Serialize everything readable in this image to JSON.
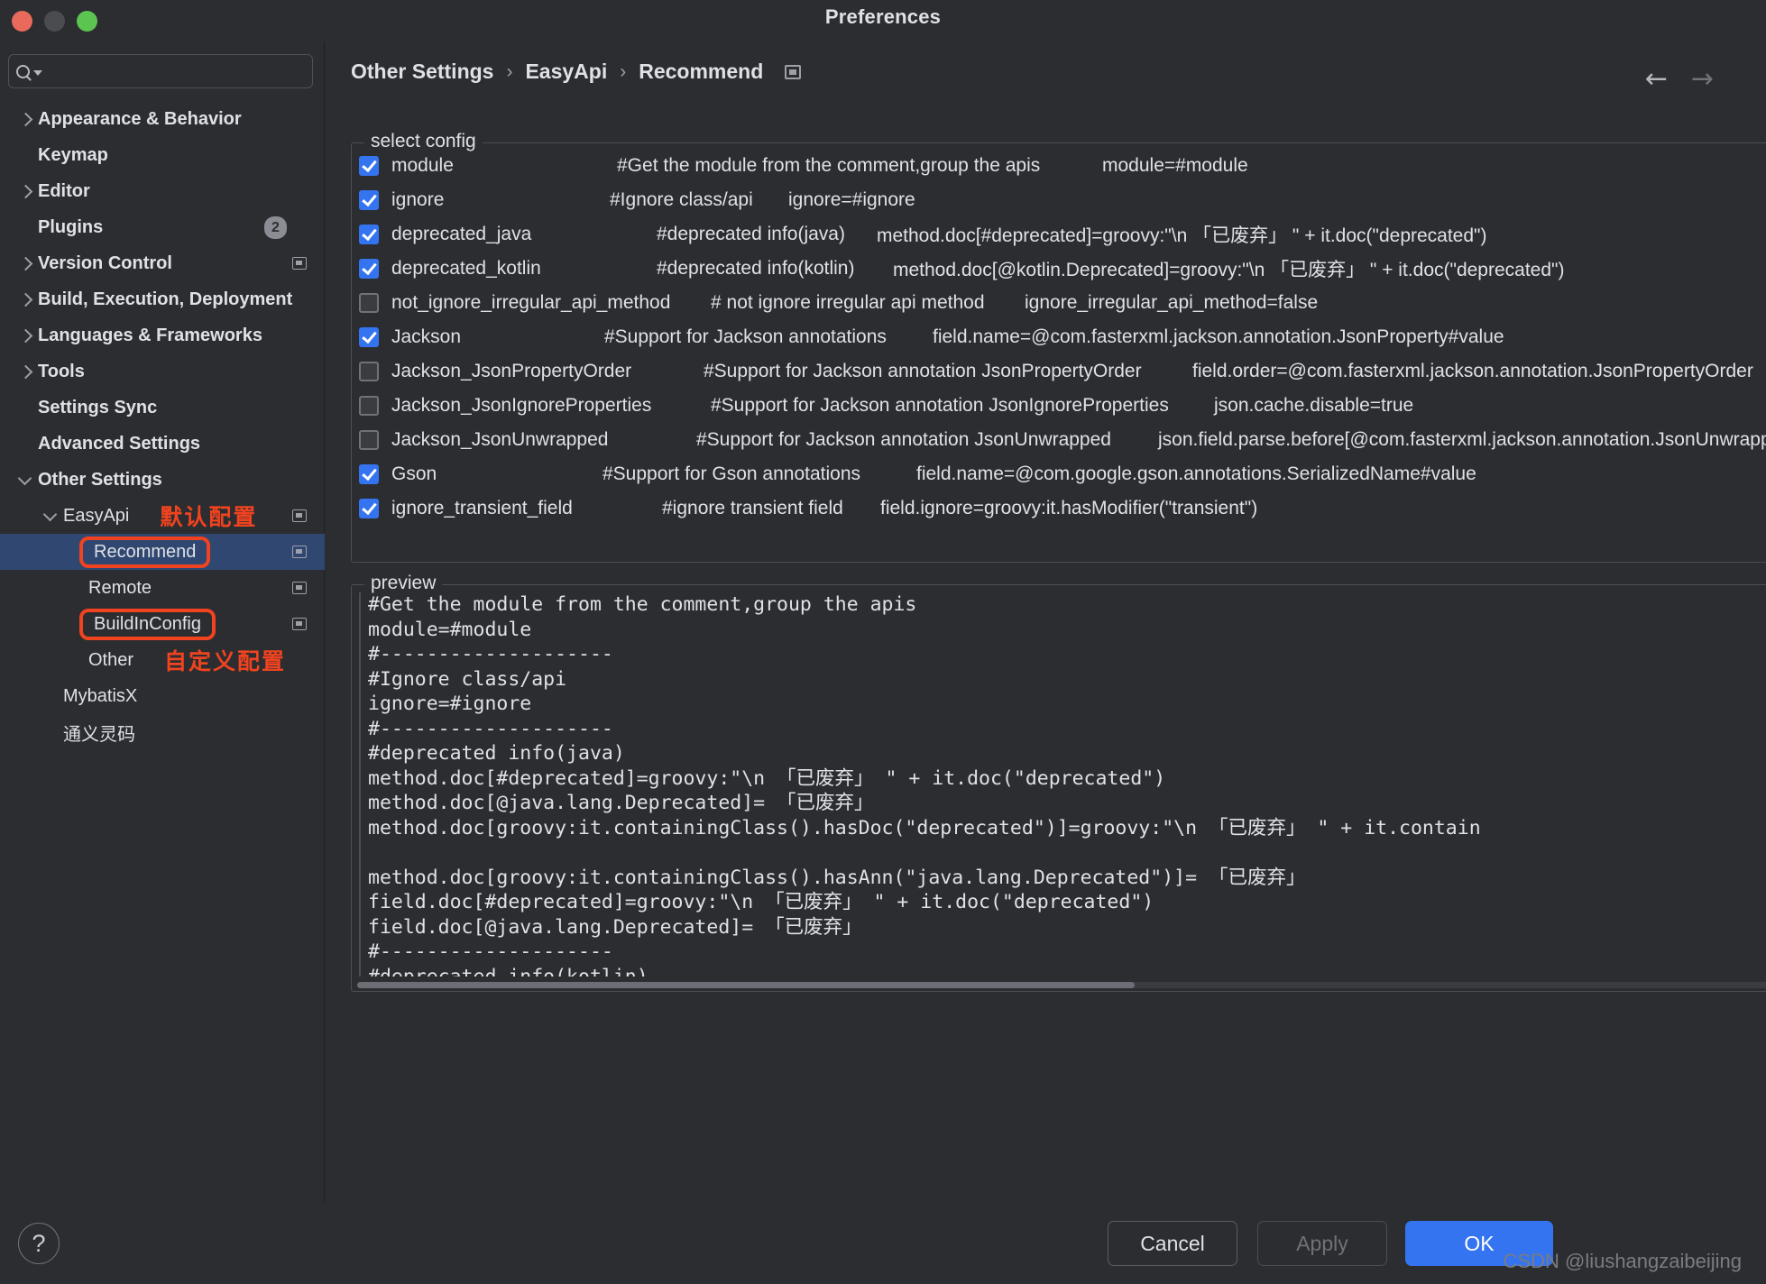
{
  "window": {
    "title": "Preferences",
    "traffic_lights": [
      "close",
      "minimize",
      "zoom"
    ]
  },
  "sidebar": {
    "search_placeholder": "",
    "search_value": "",
    "items": [
      {
        "label": "Appearance & Behavior",
        "twisty": "right",
        "indent": 0,
        "bold": true
      },
      {
        "label": "Keymap",
        "twisty": "none",
        "indent": 0,
        "bold": true
      },
      {
        "label": "Editor",
        "twisty": "right",
        "indent": 0,
        "bold": true
      },
      {
        "label": "Plugins",
        "twisty": "none",
        "indent": 0,
        "bold": true,
        "badge": "2"
      },
      {
        "label": "Version Control",
        "twisty": "right",
        "indent": 0,
        "bold": true,
        "mini": true
      },
      {
        "label": "Build, Execution, Deployment",
        "twisty": "right",
        "indent": 0,
        "bold": true
      },
      {
        "label": "Languages & Frameworks",
        "twisty": "right",
        "indent": 0,
        "bold": true
      },
      {
        "label": "Tools",
        "twisty": "right",
        "indent": 0,
        "bold": true
      },
      {
        "label": "Settings Sync",
        "twisty": "none",
        "indent": 0,
        "bold": true
      },
      {
        "label": "Advanced Settings",
        "twisty": "none",
        "indent": 0,
        "bold": true
      },
      {
        "label": "Other Settings",
        "twisty": "down",
        "indent": 0,
        "bold": true
      },
      {
        "label": "EasyApi",
        "twisty": "down",
        "indent": 1,
        "bold": false,
        "mini": true,
        "note": "默认配置"
      },
      {
        "label": "Recommend",
        "twisty": "none",
        "indent": 2,
        "bold": false,
        "selected": true,
        "highlight": true,
        "mini": true
      },
      {
        "label": "Remote",
        "twisty": "none",
        "indent": 2,
        "bold": false,
        "mini": true
      },
      {
        "label": "BuildInConfig",
        "twisty": "none",
        "indent": 2,
        "bold": false,
        "highlight": true,
        "mini": true
      },
      {
        "label": "Other",
        "twisty": "none",
        "indent": 2,
        "bold": false,
        "note": "自定义配置"
      },
      {
        "label": "MybatisX",
        "twisty": "none",
        "indent": 1,
        "bold": false
      },
      {
        "label": "通义灵码",
        "twisty": "none",
        "indent": 1,
        "bold": false
      }
    ]
  },
  "header": {
    "breadcrumb": [
      "Other Settings",
      "EasyApi",
      "Recommend"
    ],
    "separator": "›",
    "back_arrow": "←",
    "forward_arrow": "→"
  },
  "select_config": {
    "title": "select config",
    "rows": [
      {
        "checked": true,
        "name": "module",
        "desc": "#Get the module from the comment,group the apis",
        "value": "module=#module",
        "name_w": 232,
        "desc_w": 520
      },
      {
        "checked": true,
        "name": "ignore",
        "desc": "#Ignore class/api",
        "value": "ignore=#ignore",
        "name_w": 224,
        "desc_w": 180
      },
      {
        "checked": true,
        "name": "deprecated_java",
        "desc": "#deprecated info(java)",
        "value": "method.doc[#deprecated]=groovy:\"\\n 「已废弃」 \" + it.doc(\"deprecated\")",
        "name_w": 276,
        "desc_w": 226
      },
      {
        "checked": true,
        "name": "deprecated_kotlin",
        "desc": "#deprecated info(kotlin)",
        "value": "method.doc[@kotlin.Deprecated]=groovy:\"\\n 「已废弃」 \" + it.doc(\"deprecated\")",
        "name_w": 276,
        "desc_w": 244
      },
      {
        "checked": false,
        "name": "not_ignore_irregular_api_method",
        "desc": "# not ignore irregular api method",
        "value": "ignore_irregular_api_method=false",
        "name_w": 336,
        "desc_w": 330
      },
      {
        "checked": true,
        "name": "Jackson",
        "desc": "#Support for Jackson annotations",
        "value": "field.name=@com.fasterxml.jackson.annotation.JsonProperty#value",
        "name_w": 218,
        "desc_w": 346
      },
      {
        "checked": false,
        "name": "Jackson_JsonPropertyOrder",
        "desc": "#Support for Jackson annotation JsonPropertyOrder",
        "value": "field.order=@com.fasterxml.jackson.annotation.JsonPropertyOrder",
        "name_w": 328,
        "desc_w": 524
      },
      {
        "checked": false,
        "name": "Jackson_JsonIgnoreProperties",
        "desc": "#Support for Jackson annotation JsonIgnoreProperties",
        "value": "json.cache.disable=true",
        "name_w": 336,
        "desc_w": 540
      },
      {
        "checked": false,
        "name": "Jackson_JsonUnwrapped",
        "desc": "#Support for Jackson annotation JsonUnwrapped",
        "value": "json.field.parse.before[@com.fasterxml.jackson.annotation.JsonUnwrapped]",
        "name_w": 320,
        "desc_w": 494
      },
      {
        "checked": true,
        "name": "Gson",
        "desc": "#Support for Gson annotations",
        "value": "field.name=@com.google.gson.annotations.SerializedName#value",
        "name_w": 216,
        "desc_w": 330
      },
      {
        "checked": true,
        "name": "ignore_transient_field",
        "desc": "#ignore transient field",
        "value": "field.ignore=groovy:it.hasModifier(\"transient\")",
        "name_w": 282,
        "desc_w": 224
      }
    ]
  },
  "preview": {
    "title": "preview",
    "content": "#Get the module from the comment,group the apis\nmodule=#module\n#--------------------\n#Ignore class/api\nignore=#ignore\n#--------------------\n#deprecated info(java)\nmethod.doc[#deprecated]=groovy:\"\\n 「已废弃」 \" + it.doc(\"deprecated\")\nmethod.doc[@java.lang.Deprecated]= 「已废弃」\nmethod.doc[groovy:it.containingClass().hasDoc(\"deprecated\")]=groovy:\"\\n 「已废弃」 \" + it.contain\n\nmethod.doc[groovy:it.containingClass().hasAnn(\"java.lang.Deprecated\")]= 「已废弃」\nfield.doc[#deprecated]=groovy:\"\\n 「已废弃」 \" + it.doc(\"deprecated\")\nfield.doc[@java.lang.Deprecated]= 「已废弃」\n#--------------------\n#deprecated info(kotlin)"
  },
  "footer": {
    "help_glyph": "?",
    "cancel_label": "Cancel",
    "apply_label": "Apply",
    "ok_label": "OK",
    "watermark": "CSDN @liushangzaibeijing"
  },
  "colors": {
    "accent": "#3574f0",
    "selection": "#2f4771",
    "highlight_outline": "#f0431f",
    "background": "#2b2d30",
    "text": "#dfe1e5"
  }
}
